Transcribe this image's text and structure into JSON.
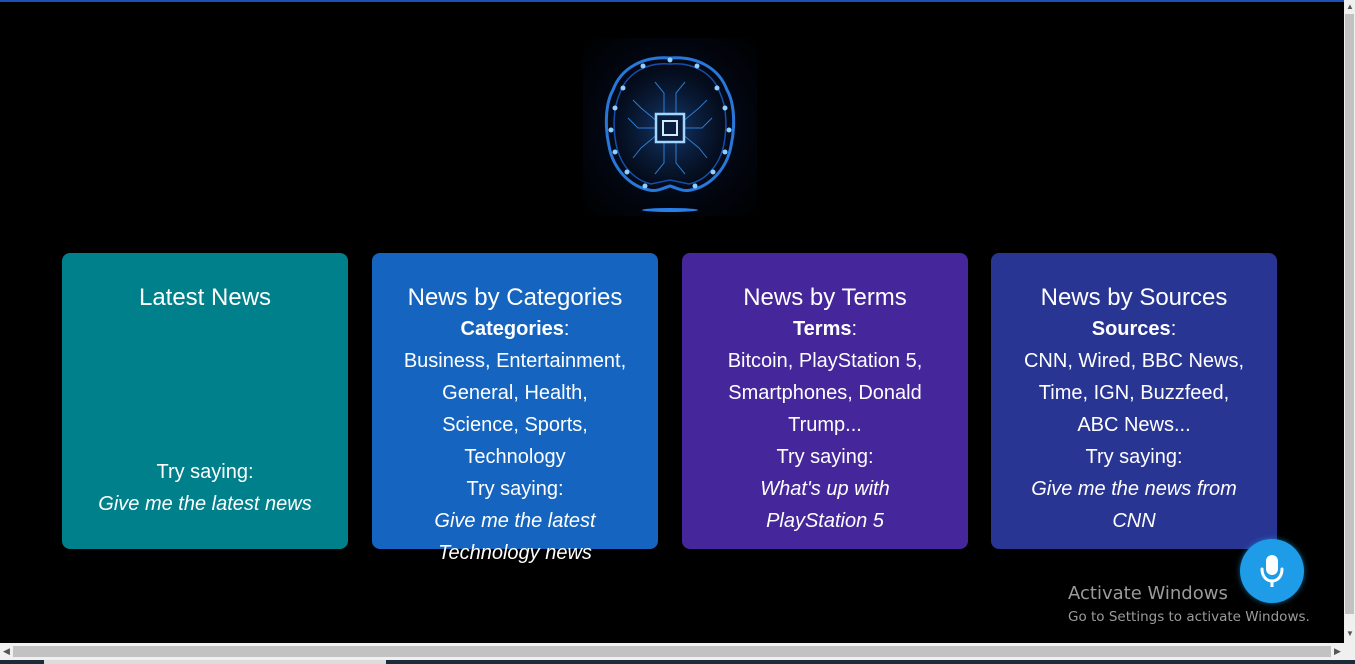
{
  "logo": {
    "icon": "ai-brain-chip-icon",
    "accent": "#3aa7ff"
  },
  "cards": [
    {
      "title": "Latest News",
      "try_label": "Try saying:",
      "example": "Give me the latest news",
      "color": "#00808a"
    },
    {
      "title": "News by Categories",
      "list_label": "Categories",
      "list_colon": ":",
      "list_lines": [
        "Business, Entertainment,",
        "General, Health,",
        "Science, Sports,",
        "Technology"
      ],
      "try_label": "Try saying:",
      "example_lines": [
        "Give me the latest",
        "Technology news"
      ],
      "color": "#1565c0"
    },
    {
      "title": "News by Terms",
      "list_label": "Terms",
      "list_colon": ":",
      "list_lines": [
        "Bitcoin, PlayStation 5,",
        "Smartphones, Donald",
        "Trump..."
      ],
      "try_label": "Try saying:",
      "example_lines": [
        "What's up with",
        "PlayStation 5"
      ],
      "color": "#45279b"
    },
    {
      "title": "News by Sources",
      "list_label": "Sources",
      "list_colon": ":",
      "list_lines": [
        "CNN, Wired, BBC News,",
        "Time, IGN, Buzzfeed,",
        "ABC News..."
      ],
      "try_label": "Try saying:",
      "example_lines": [
        "Give me the news from",
        "CNN"
      ],
      "color": "#283593"
    }
  ],
  "mic_button": {
    "icon": "microphone-icon",
    "color": "#1e9ce8"
  },
  "watermark": {
    "title": "Activate Windows",
    "subtitle": "Go to Settings to activate Windows."
  }
}
